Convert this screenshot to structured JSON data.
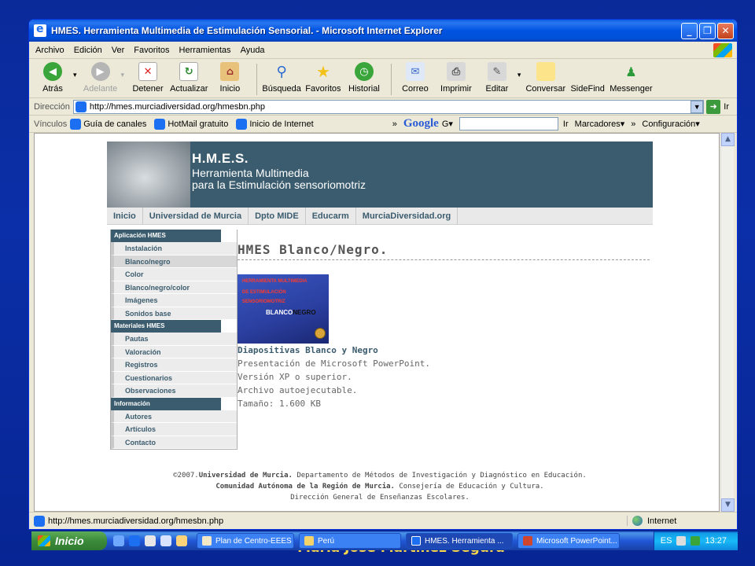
{
  "slide_footer": "María José Martínez Segura",
  "window": {
    "title": "HMES. Herramienta Multimedia de Estimulación Sensorial. - Microsoft Internet Explorer",
    "min": "_",
    "max": "❐",
    "close": "✕"
  },
  "menu": [
    "Archivo",
    "Edición",
    "Ver",
    "Favoritos",
    "Herramientas",
    "Ayuda"
  ],
  "toolbar": {
    "back": "Atrás",
    "forward": "Adelante",
    "stop": "Detener",
    "refresh": "Actualizar",
    "home": "Inicio",
    "search": "Búsqueda",
    "favorites": "Favoritos",
    "history": "Historial",
    "mail": "Correo",
    "print": "Imprimir",
    "edit": "Editar",
    "discuss": "Conversar",
    "sidefind": "SideFind",
    "messenger": "Messenger"
  },
  "address": {
    "label": "Dirección",
    "url": "http://hmes.murciadiversidad.org/hmesbn.php",
    "go": "Ir"
  },
  "links": {
    "label": "Vínculos",
    "items": [
      "Guía de canales",
      "HotMail gratuito",
      "Inicio de Internet"
    ],
    "more": "»",
    "google": "Google",
    "google_g": "G▾",
    "go": "Ir",
    "marcadores": "Marcadores▾",
    "more2": "»",
    "config": "Configuración▾"
  },
  "site": {
    "banner_title": "H.M.E.S.",
    "banner_sub1": "Herramienta Multimedia",
    "banner_sub2": "para la Estimulación sensoriomotriz",
    "nav": [
      "Inicio",
      "Universidad de Murcia",
      "Dpto MIDE",
      "Educarm",
      "MurciaDiversidad.org"
    ],
    "sidebar": {
      "sections": [
        {
          "head": "Aplicación HMES",
          "items": [
            "Instalación",
            "Blanco/negro",
            "Color",
            "Blanco/negro/color",
            "Imágenes",
            "Sonidos base"
          ]
        },
        {
          "head": "Materiales HMES",
          "items": [
            "Pautas",
            "Valoración",
            "Registros",
            "Cuestionarios",
            "Observaciones"
          ]
        },
        {
          "head": "Información",
          "items": [
            "Autores",
            "Artículos",
            "Contacto"
          ]
        }
      ]
    },
    "main_title": "HMES Blanco/Negro.",
    "cover": {
      "line1": "HERRAMIENTA MULTIMEDIA",
      "line2": "DE ESTIMULACIÓN",
      "line3": "SENSORIOMOTRIZ",
      "blanco": "BLANCO",
      "negro": "NEGRO"
    },
    "item_title": "Diapositivas Blanco y Negro",
    "item_lines": [
      "Presentación de Microsoft PowerPoint.",
      "Versión XP o superior.",
      "Archivo autoejecutable.",
      "Tamaño: 1.600 KB"
    ],
    "footer": {
      "l1a": "©2007.",
      "l1b": "Universidad de Murcia.",
      "l1c": " Departamento de Métodos de Investigación y Diagnóstico en Educación.",
      "l2a": "Comunidad Autónoma de la Región de Murcia.",
      "l2b": " Consejería de Educación y Cultura.",
      "l3": "Dirección General de Enseñanzas Escolares."
    }
  },
  "status": {
    "url": "http://hmes.murciadiversidad.org/hmesbn.php",
    "zone": "Internet"
  },
  "taskbar": {
    "start": "Inicio",
    "tasks": [
      "Plan de Centro-EEES ...",
      "Perú",
      "HMES. Herramienta ...",
      "Microsoft PowerPoint..."
    ],
    "lang": "ES",
    "time": "13:27"
  }
}
